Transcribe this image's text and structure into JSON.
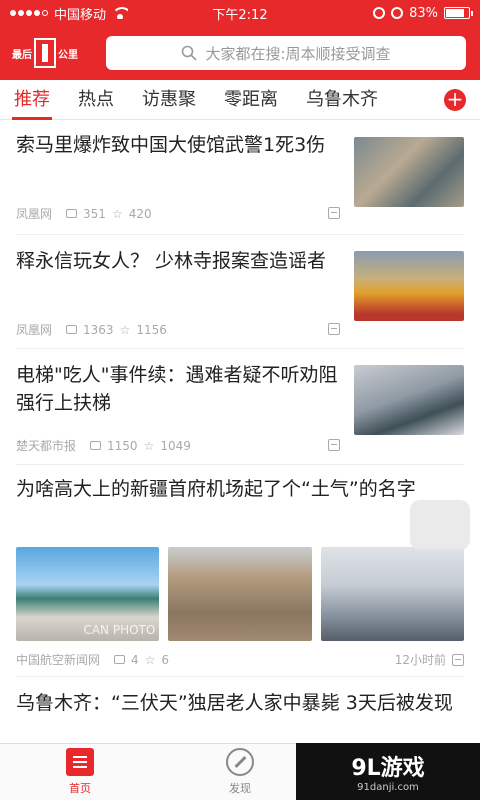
{
  "statusbar": {
    "carrier": "中国移动",
    "time": "下午2:12",
    "battery": "83%",
    "battery_level": 0.83
  },
  "header": {
    "logo_text": "最后",
    "logo_sub": "公里",
    "search_placeholder": "大家都在搜:周本顺接受调查"
  },
  "tabs": [
    "推荐",
    "热点",
    "访惠聚",
    "零距离",
    "乌鲁木齐"
  ],
  "tab_add": "+",
  "articles": [
    {
      "title": "索马里爆炸致中国大使馆武警1死3伤",
      "source": "凤凰网",
      "comments": "351",
      "favorites": "420"
    },
    {
      "title": "释永信玩女人？ 少林寺报案查造谣者",
      "source": "凤凰网",
      "comments": "1363",
      "favorites": "1156"
    },
    {
      "title": "电梯\"吃人\"事件续：遇难者疑不听劝阻强行上扶梯",
      "source": "楚天都市报",
      "comments": "1150",
      "favorites": "1049"
    },
    {
      "title": "为啥高大上的新疆首府机场起了个“土气”的名字",
      "source": "中国航空新闻网",
      "comments": "4",
      "favorites": "6",
      "time": "12小时前",
      "pic_caption": "CAN PHOTO"
    },
    {
      "title": "乌鲁木齐：“三伏天”独居老人家中暴毙 3天后被发现"
    }
  ],
  "tabbar": {
    "home": "首页",
    "discover": "发现"
  },
  "watermark": {
    "big": "9L游戏",
    "small": "91danji.com"
  },
  "colors": {
    "accent": "#e8292c"
  }
}
